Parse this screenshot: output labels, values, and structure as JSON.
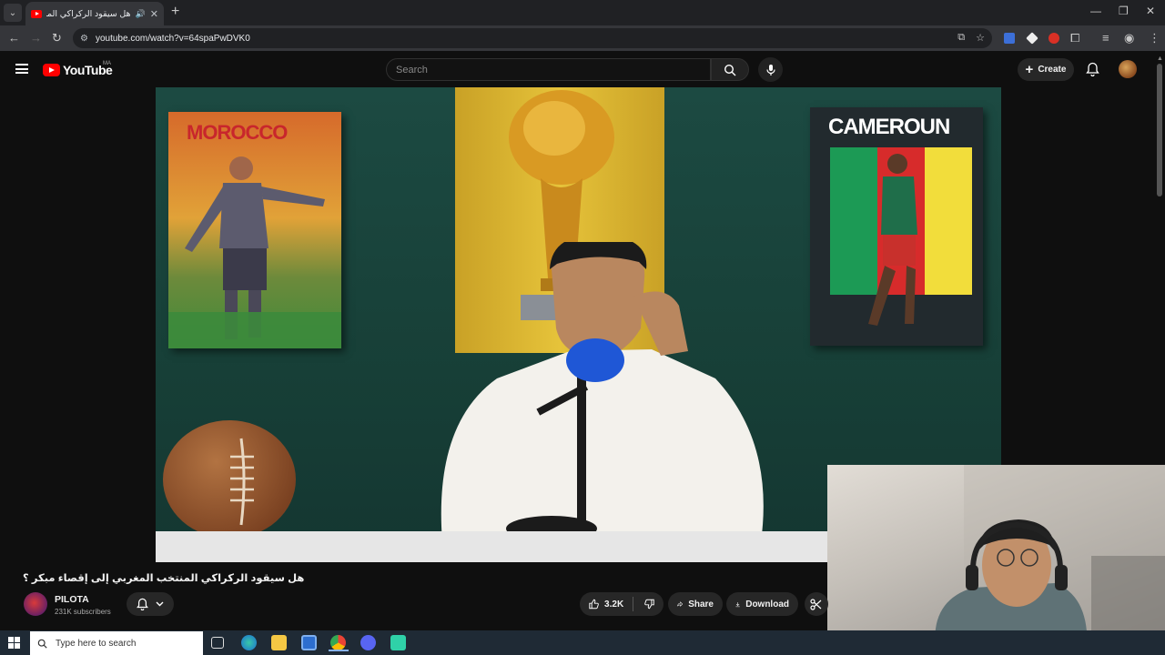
{
  "browser": {
    "tab_title": "هل سيقود الركراكي المنتخب",
    "url": "youtube.com/watch?v=64spaPwDVK0",
    "new_tab_symbol": "+",
    "close_symbol": "✕",
    "audio_symbol": "🔊",
    "window_controls": [
      "—",
      "❐",
      "✕"
    ]
  },
  "youtube": {
    "logo_text": "YouTube",
    "country_code": "MA",
    "search_placeholder": "Search",
    "create_label": "Create"
  },
  "video_frame": {
    "poster_left_text": "MOROCCO",
    "poster_right_text": "CAMEROUN",
    "colors": {
      "wall": "#1c4a42",
      "yellow_panel": "#e6c33a",
      "sweater": "#f3f1ec",
      "mic": "#1f57d6"
    }
  },
  "video": {
    "title": "هل سيقود الركراكي المنتخب المغربي إلى إقصاء مبكر ؟",
    "channel_name": "PILOTA",
    "subscribers": "231K subscribers",
    "like_count": "3.2K",
    "share_label": "Share",
    "download_label": "Download"
  },
  "taskbar": {
    "search_placeholder": "Type here to search"
  },
  "icons": {
    "browser": [
      "tab-search-icon",
      "youtube-favicon",
      "back-icon",
      "forward-icon",
      "reload-icon",
      "site-info-icon",
      "install-icon",
      "bookmark-star-icon",
      "extensions-icon",
      "media-icon",
      "profile-icon",
      "kebab-menu-icon"
    ],
    "youtube": [
      "menu-icon",
      "search-icon",
      "mic-icon",
      "plus-icon",
      "bell-icon",
      "like-icon",
      "dislike-icon",
      "share-icon",
      "download-icon",
      "clip-icon"
    ],
    "taskbar": [
      "windows-start-icon",
      "task-view-icon",
      "edge-icon",
      "file-explorer-icon",
      "store-icon",
      "chrome-icon",
      "discord-icon",
      "game-icon"
    ]
  }
}
